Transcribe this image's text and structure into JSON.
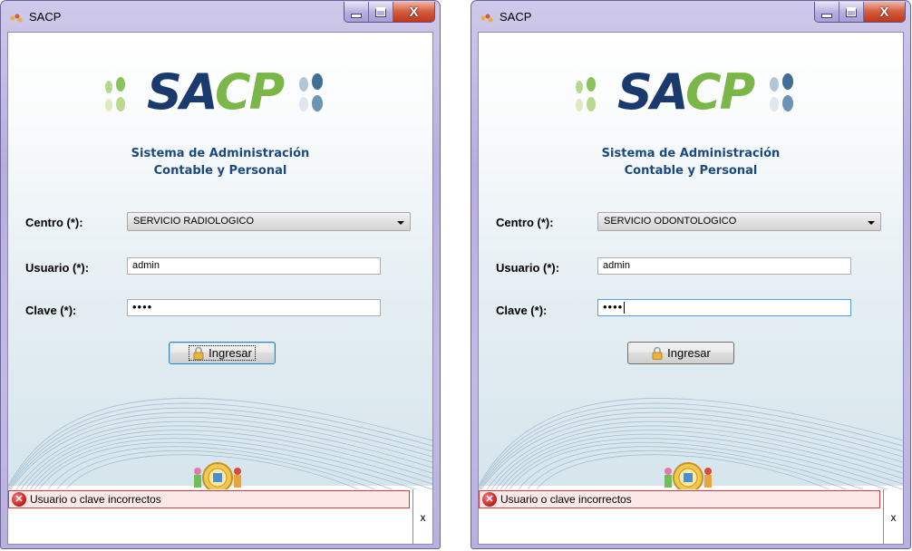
{
  "windows": [
    {
      "title": "SACP",
      "logo_prefix": "SA",
      "logo_suffix": "CP",
      "subtitle_line1": "Sistema de Administración",
      "subtitle_line2": "Contable y Personal",
      "centro_label": "Centro (*):",
      "centro_value": "SERVICIO RADIOLOGICO",
      "usuario_label": "Usuario (*):",
      "usuario_value": "admin",
      "clave_label": "Clave (*):",
      "clave_value": "••••",
      "ingresar_label": "Ingresar",
      "error_message": "Usuario o clave incorrectos",
      "close_label": "X",
      "close_caption": "x"
    },
    {
      "title": "SACP",
      "logo_prefix": "SA",
      "logo_suffix": "CP",
      "subtitle_line1": "Sistema de Administración",
      "subtitle_line2": "Contable y Personal",
      "centro_label": "Centro (*):",
      "centro_value": "SERVICIO ODONTOLOGICO",
      "usuario_label": "Usuario (*):",
      "usuario_value": "admin",
      "clave_label": "Clave (*):",
      "clave_value": "••••",
      "ingresar_label": "Ingresar",
      "error_message": "Usuario o clave incorrectos",
      "close_label": "X",
      "close_caption": "x"
    }
  ],
  "colors": {
    "logo_navy": "#1a3a6f",
    "logo_green": "#7ab648",
    "subtitle_blue": "#1c4980",
    "error_border": "#d43a3a",
    "error_bg": "#fde8e8"
  }
}
